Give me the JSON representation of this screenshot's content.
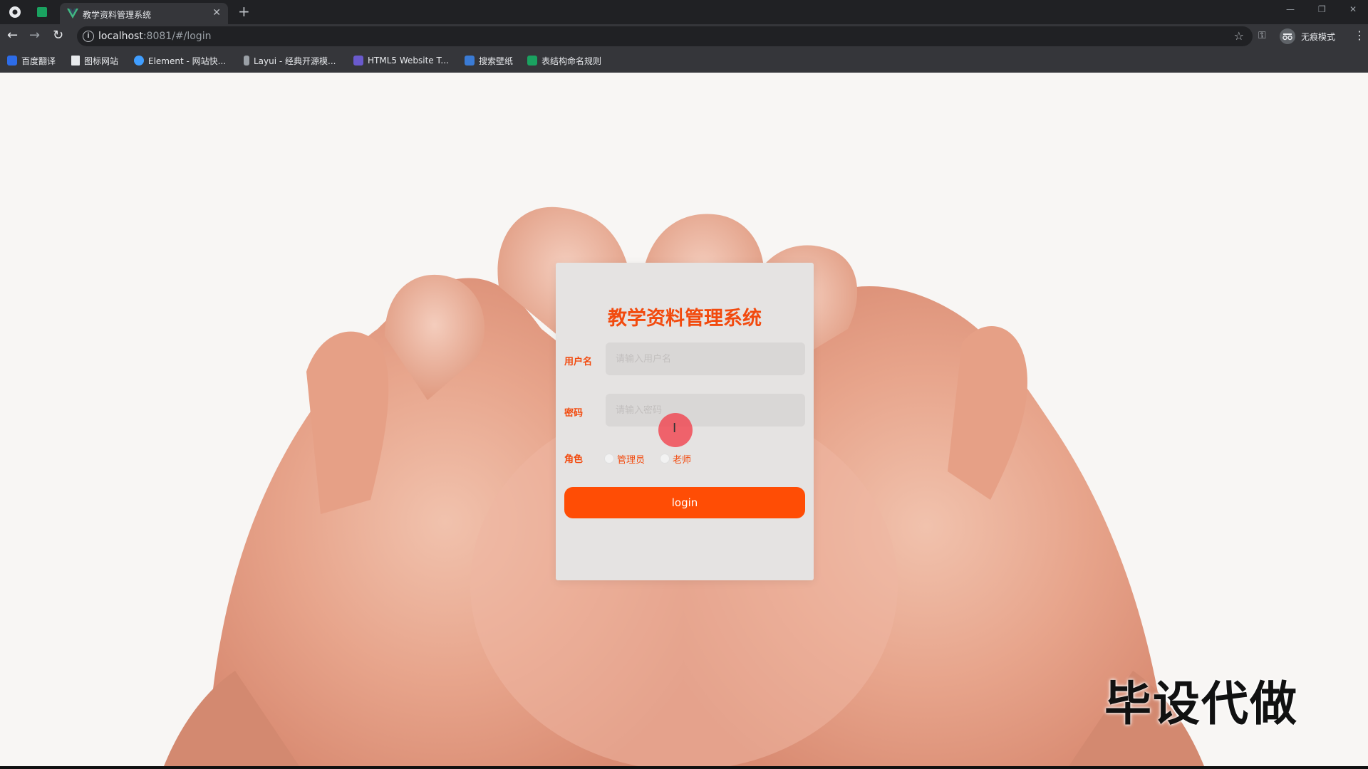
{
  "browser": {
    "tab_title": "教学资料管理系统",
    "url_host": "localhost",
    "url_rest": ":8081/#/login",
    "profile_label": "无痕模式"
  },
  "bookmarks": [
    {
      "label": "百度翻译",
      "icon": "baidu-translate-icon",
      "color": "#2d6ce8"
    },
    {
      "label": "图标网站",
      "icon": "flag-icon",
      "color": "#ffffff"
    },
    {
      "label": "Element - 网站快...",
      "icon": "element-icon",
      "color": "#409eff"
    },
    {
      "label": "Layui - 经典开源模...",
      "icon": "layui-icon",
      "color": "#bdc1c6"
    },
    {
      "label": "HTML5 Website T...",
      "icon": "html5-icon",
      "color": "#6a5acd"
    },
    {
      "label": "搜索壁纸",
      "icon": "wallpaper-icon",
      "color": "#3a7bd5"
    },
    {
      "label": "表结构命名规则",
      "icon": "sheet-icon",
      "color": "#1aa260"
    }
  ],
  "login": {
    "title": "教学资料管理系统",
    "username_label": "用户名",
    "username_placeholder": "请输入用户名",
    "password_label": "密码",
    "password_placeholder": "请输入密码",
    "role_label": "角色",
    "role_options": [
      "管理员",
      "老师"
    ],
    "button_label": "login"
  },
  "watermark": "毕设代做",
  "colors": {
    "accent": "#f24a0e",
    "button": "#ff4d05",
    "card": "#e5e3e2"
  }
}
